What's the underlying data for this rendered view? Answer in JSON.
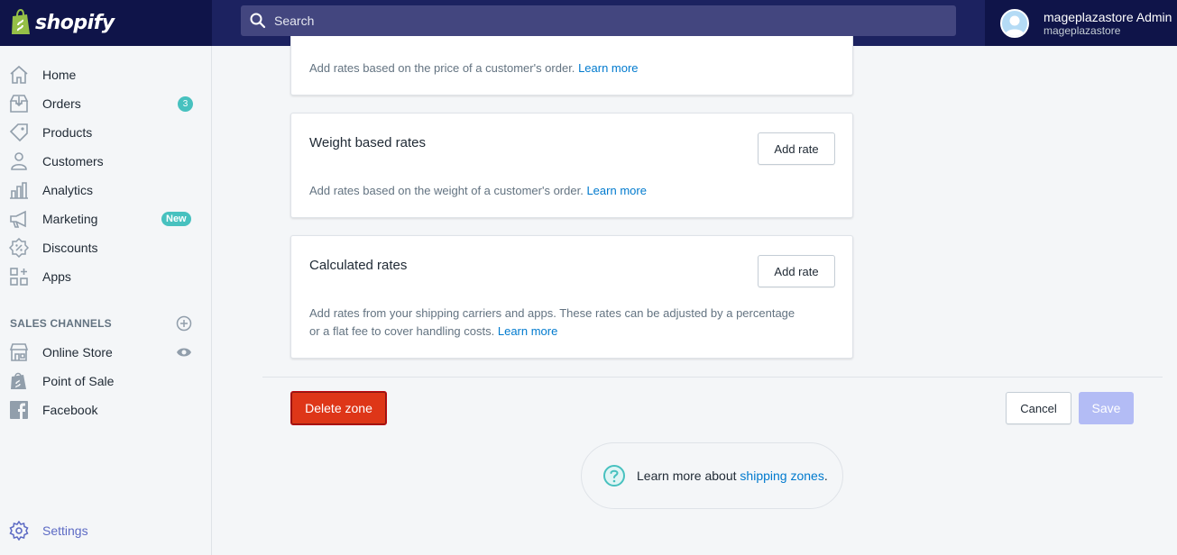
{
  "topbar": {
    "logo_text": "shopify",
    "search_placeholder": "Search",
    "user_name": "mageplazastore Admin",
    "user_store": "mageplazastore"
  },
  "sidebar": {
    "items": [
      {
        "label": "Home",
        "icon": "home-icon"
      },
      {
        "label": "Orders",
        "icon": "orders-icon",
        "badge": "3"
      },
      {
        "label": "Products",
        "icon": "tag-icon"
      },
      {
        "label": "Customers",
        "icon": "person-icon"
      },
      {
        "label": "Analytics",
        "icon": "bar-chart-icon"
      },
      {
        "label": "Marketing",
        "icon": "megaphone-icon",
        "badge": "New"
      },
      {
        "label": "Discounts",
        "icon": "discount-icon"
      },
      {
        "label": "Apps",
        "icon": "apps-icon"
      }
    ],
    "sales_channels_heading": "SALES CHANNELS",
    "channels": [
      {
        "label": "Online Store",
        "icon": "store-icon"
      },
      {
        "label": "Point of Sale",
        "icon": "shopping-bag-icon"
      },
      {
        "label": "Facebook",
        "icon": "facebook-icon"
      }
    ],
    "settings_label": "Settings"
  },
  "main": {
    "price_card": {
      "desc": "Add rates based on the price of a customer's order.",
      "link": "Learn more"
    },
    "weight_card": {
      "title": "Weight based rates",
      "button": "Add rate",
      "desc": "Add rates based on the weight of a customer's order.",
      "link": "Learn more"
    },
    "calculated_card": {
      "title": "Calculated rates",
      "button": "Add rate",
      "desc_line1": "Add rates from your shipping carriers and apps. These rates can be adjusted by a percentage",
      "desc_line2": "or a flat fee to cover handling costs.",
      "link": "Learn more"
    },
    "delete_button": "Delete zone",
    "cancel_button": "Cancel",
    "save_button": "Save",
    "help_text": "Learn more about",
    "help_link": "shipping zones",
    "help_suffix": "."
  },
  "colors": {
    "topbar": "#1c2260",
    "accent": "#5c6ac4",
    "danger": "#de3618",
    "link": "#007ace",
    "badge": "#47c1bf"
  }
}
